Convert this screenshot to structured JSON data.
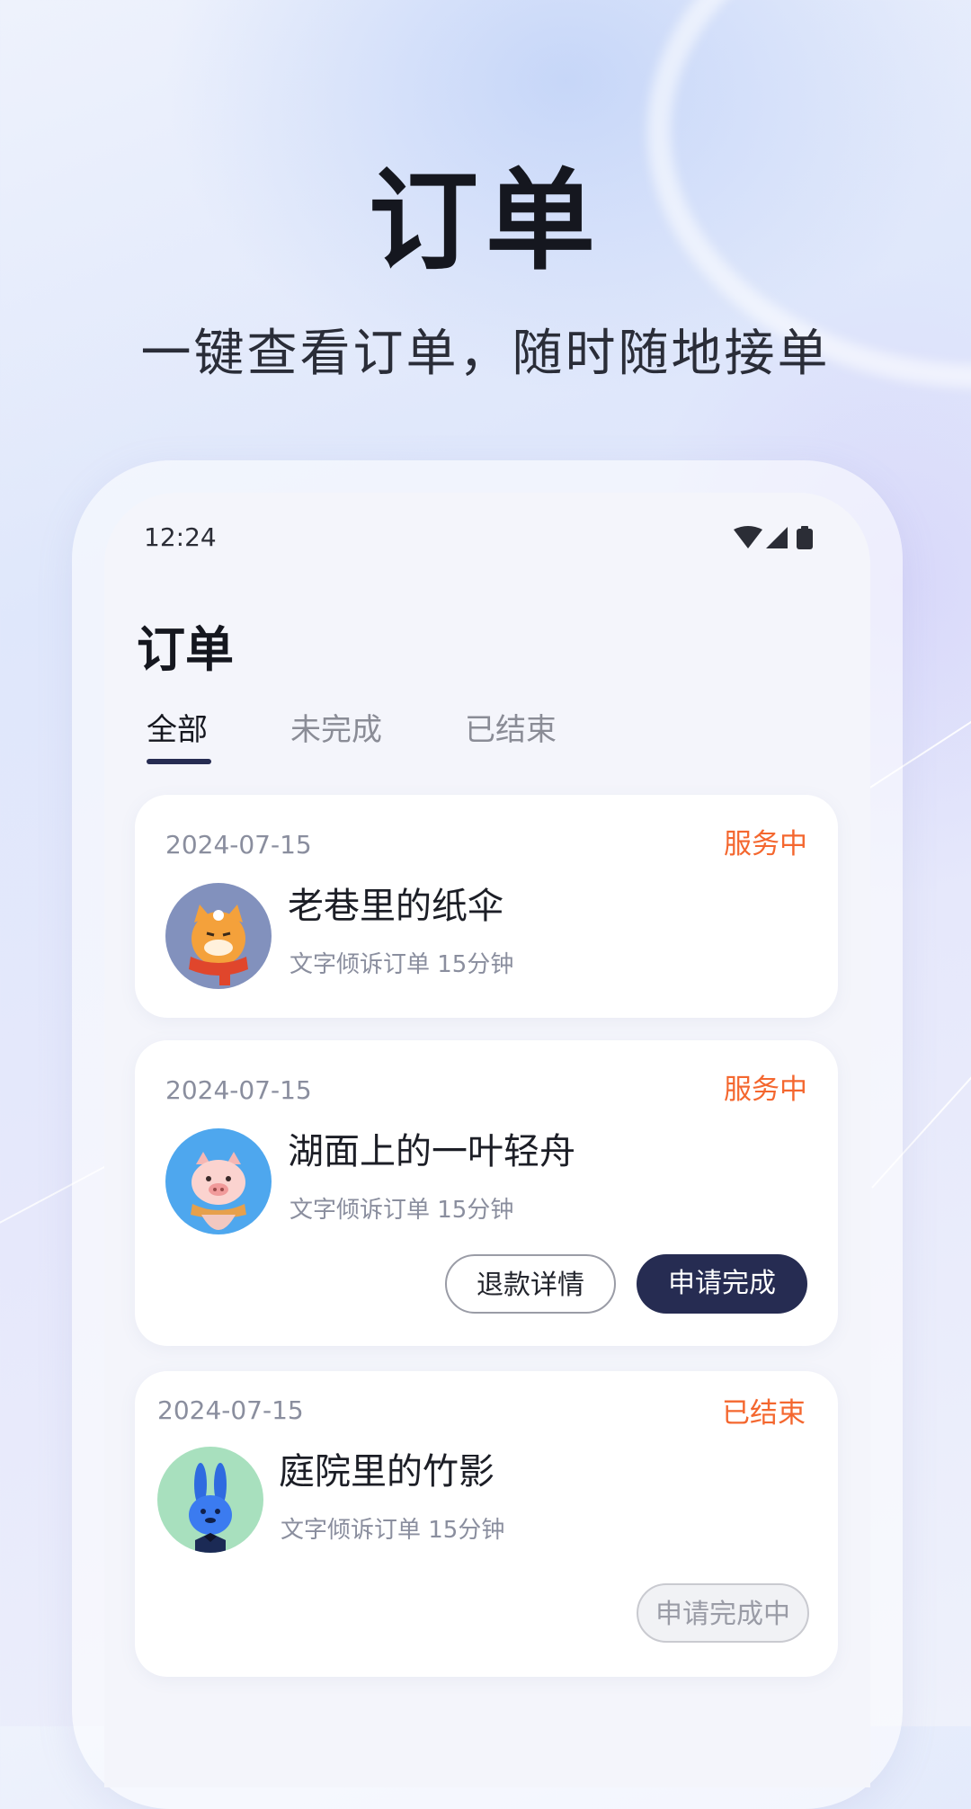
{
  "hero": {
    "title": "订单",
    "subtitle": "一键查看订单，随时随地接单"
  },
  "status_bar": {
    "time": "12:24",
    "icons": [
      "wifi-icon",
      "signal-icon",
      "battery-icon"
    ]
  },
  "app": {
    "title": "订单",
    "tabs": [
      {
        "label": "全部",
        "active": true
      },
      {
        "label": "未完成",
        "active": false
      },
      {
        "label": "已结束",
        "active": false
      }
    ]
  },
  "orders": [
    {
      "date": "2024-07-15",
      "status": "服务中",
      "name": "老巷里的纸伞",
      "desc": "文字倾诉订单 15分钟",
      "avatar": "cat-avatar"
    },
    {
      "date": "2024-07-15",
      "status": "服务中",
      "name": "湖面上的一叶轻舟",
      "desc": "文字倾诉订单 15分钟",
      "avatar": "pig-avatar",
      "buttons": {
        "refund": "退款详情",
        "complete": "申请完成"
      }
    },
    {
      "date": "2024-07-15",
      "status": "已结束",
      "name": "庭院里的竹影",
      "desc": "文字倾诉订单 15分钟",
      "avatar": "rabbit-avatar",
      "buttons": {
        "pending": "申请完成中"
      }
    }
  ],
  "colors": {
    "accent": "#262c52",
    "status": "#f4672f",
    "muted": "#8a8e9e"
  }
}
